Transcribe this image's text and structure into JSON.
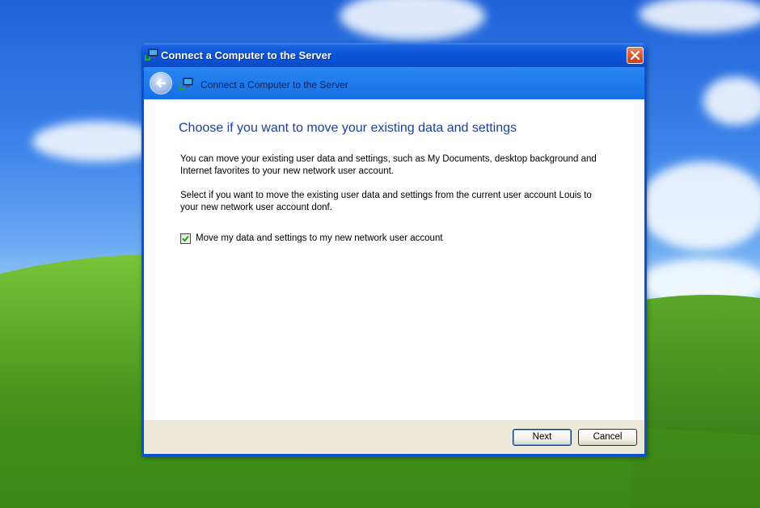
{
  "window": {
    "title": "Connect a Computer to the Server"
  },
  "nav": {
    "title": "Connect a Computer to the Server",
    "back_icon": "back-arrow-icon"
  },
  "content": {
    "heading": "Choose if you want to move your existing data and settings",
    "paragraph1": "You can move your existing user data and settings, such as My Documents, desktop background and Internet favorites to your new network user account.",
    "paragraph2": "Select if you want to move the existing user data and settings from the current user account Louis to your new network user account donf.",
    "checkbox_label": "Move my data and settings to my new network user account",
    "checkbox_checked": true
  },
  "footer": {
    "next_label": "Next",
    "cancel_label": "Cancel"
  },
  "colors": {
    "titlebar": "#0a55d8",
    "heading": "#1a3f9c",
    "footer": "#ece9d8",
    "close": "#e0582e"
  }
}
